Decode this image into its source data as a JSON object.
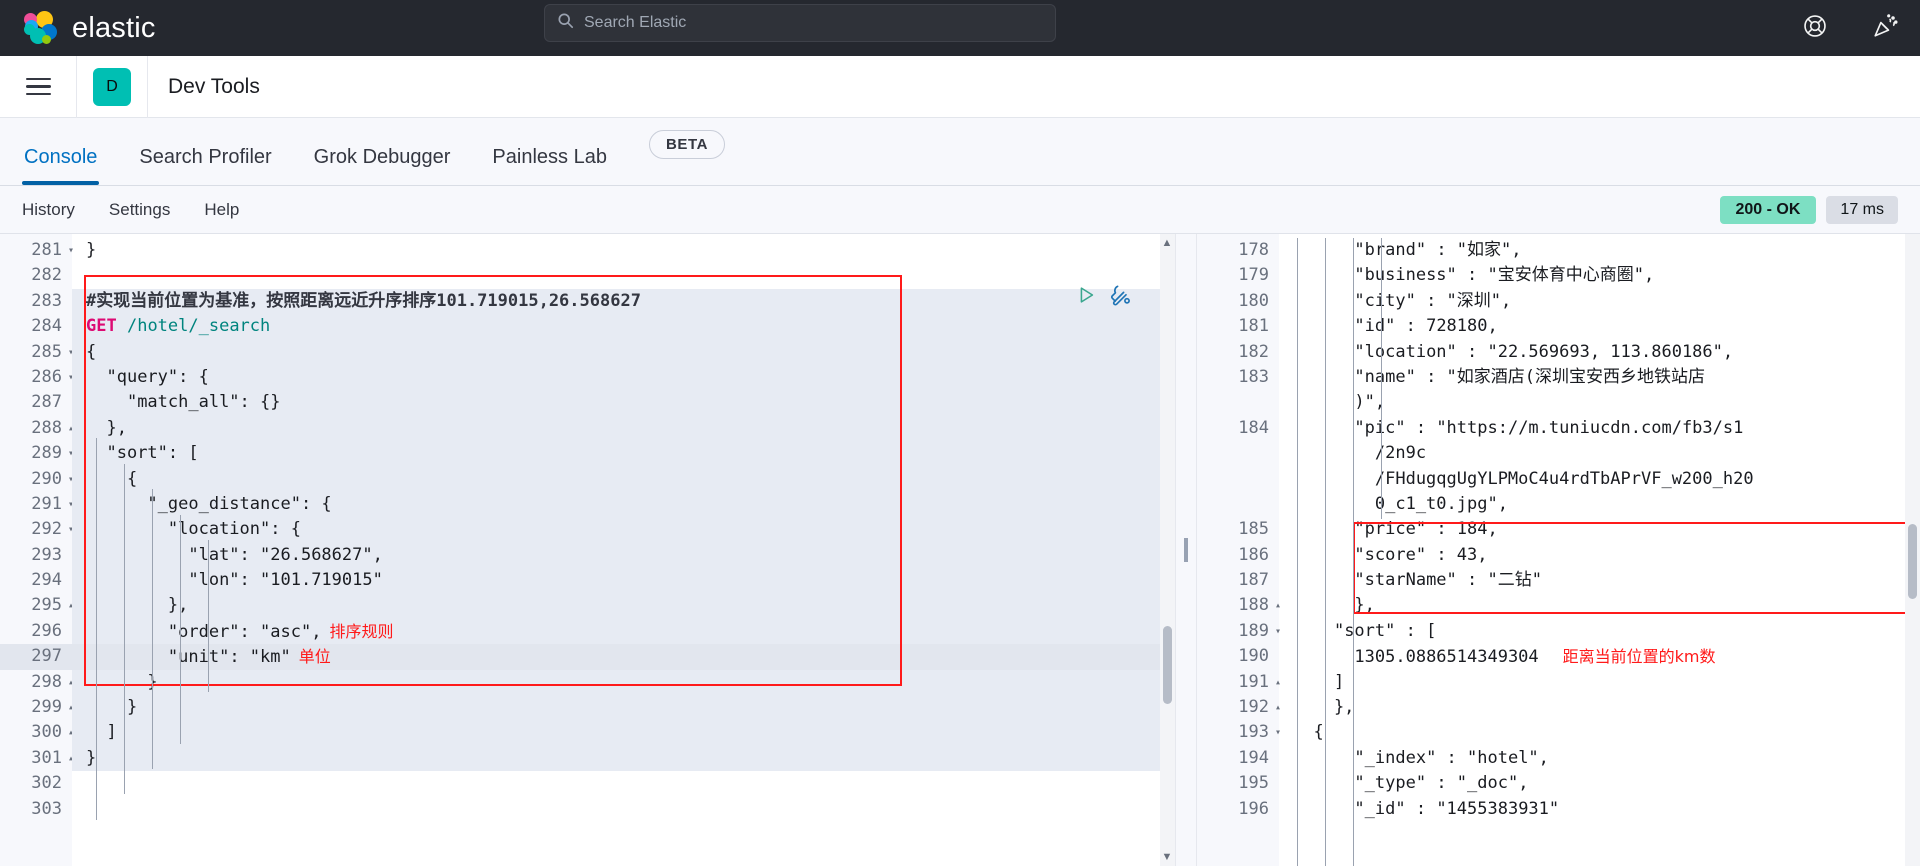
{
  "header": {
    "brand": "elastic",
    "search_placeholder": "Search Elastic",
    "icons": {
      "help": "lifebuoy-icon",
      "whats_new": "party-popper-icon"
    }
  },
  "appbar": {
    "menu_icon": "hamburger-menu-icon",
    "space_badge": "D",
    "title": "Dev Tools"
  },
  "tabs": [
    {
      "label": "Console",
      "active": true
    },
    {
      "label": "Search Profiler",
      "active": false
    },
    {
      "label": "Grok Debugger",
      "active": false
    },
    {
      "label": "Painless Lab",
      "active": false
    }
  ],
  "beta_tag": "BETA",
  "console_toolbar": {
    "items": [
      "History",
      "Settings",
      "Help"
    ],
    "status_code": "200 - OK",
    "status_time": "17 ms"
  },
  "editor": {
    "first_line": 281,
    "lines": [
      {
        "n": 281,
        "fold": "down",
        "text": "}"
      },
      {
        "n": 282,
        "fold": "",
        "text": ""
      },
      {
        "n": 283,
        "fold": "",
        "text": "#实现当前位置为基准，按照距离远近升序排序101.719015,26.568627"
      },
      {
        "n": 284,
        "fold": "",
        "text": "GET /hotel/_search"
      },
      {
        "n": 285,
        "fold": "down",
        "text": "{"
      },
      {
        "n": 286,
        "fold": "down",
        "text": "  \"query\": {"
      },
      {
        "n": 287,
        "fold": "",
        "text": "    \"match_all\": {}"
      },
      {
        "n": 288,
        "fold": "up",
        "text": "  },"
      },
      {
        "n": 289,
        "fold": "down",
        "text": "  \"sort\": ["
      },
      {
        "n": 290,
        "fold": "down",
        "text": "    {"
      },
      {
        "n": 291,
        "fold": "down",
        "text": "      \"_geo_distance\": {"
      },
      {
        "n": 292,
        "fold": "down",
        "text": "        \"location\": {"
      },
      {
        "n": 293,
        "fold": "",
        "text": "          \"lat\": \"26.568627\","
      },
      {
        "n": 294,
        "fold": "",
        "text": "          \"lon\": \"101.719015\""
      },
      {
        "n": 295,
        "fold": "up",
        "text": "        },"
      },
      {
        "n": 296,
        "fold": "",
        "text": "        \"order\": \"asc\","
      },
      {
        "n": 297,
        "fold": "",
        "text": "        \"unit\": \"km\""
      },
      {
        "n": 298,
        "fold": "up",
        "text": "      }"
      },
      {
        "n": 299,
        "fold": "up",
        "text": "    }"
      },
      {
        "n": 300,
        "fold": "up",
        "text": "  ]"
      },
      {
        "n": 301,
        "fold": "up",
        "text": "}"
      },
      {
        "n": 302,
        "fold": "",
        "text": ""
      },
      {
        "n": 303,
        "fold": "",
        "text": ""
      }
    ],
    "annotations": [
      {
        "text": "排序规则",
        "for_line": 296
      },
      {
        "text": "单位",
        "for_line": 297
      }
    ],
    "run_icon": "play-triangle-icon",
    "wrench_icon": "wrench-icon",
    "highlighted_line": 297
  },
  "response": {
    "first_line": 178,
    "lines": [
      {
        "n": 178,
        "fold": "",
        "text": "\"brand\" : \"如家\","
      },
      {
        "n": 179,
        "fold": "",
        "text": "\"business\" : \"宝安体育中心商圈\","
      },
      {
        "n": 180,
        "fold": "",
        "text": "\"city\" : \"深圳\","
      },
      {
        "n": 181,
        "fold": "",
        "text": "\"id\" : 728180,"
      },
      {
        "n": 182,
        "fold": "",
        "text": "\"location\" : \"22.569693, 113.860186\","
      },
      {
        "n": 183,
        "fold": "",
        "text": "\"name\" : \"如家酒店(深圳宝安西乡地铁站店)\","
      },
      {
        "n": 184,
        "fold": "",
        "text": "\"pic\" : \"https://m.tuniucdn.com/fb3/s1/2n9c/FHdugqgUgYLPMoC4u4rdTbAPrVF_w200_h200_c1_t0.jpg\","
      },
      {
        "n": 185,
        "fold": "",
        "text": "\"price\" : 184,"
      },
      {
        "n": 186,
        "fold": "",
        "text": "\"score\" : 43,"
      },
      {
        "n": 187,
        "fold": "",
        "text": "\"starName\" : \"二钻\""
      },
      {
        "n": 188,
        "fold": "up",
        "text": "},"
      },
      {
        "n": 189,
        "fold": "down",
        "text": "\"sort\" : ["
      },
      {
        "n": 190,
        "fold": "",
        "text": "  1305.0886514349304"
      },
      {
        "n": 191,
        "fold": "up",
        "text": "]"
      },
      {
        "n": 192,
        "fold": "up",
        "text": "},"
      },
      {
        "n": 193,
        "fold": "down",
        "text": "{"
      },
      {
        "n": 194,
        "fold": "",
        "text": "\"_index\" : \"hotel\","
      },
      {
        "n": 195,
        "fold": "",
        "text": "\"_type\" : \"_doc\","
      },
      {
        "n": 196,
        "fold": "",
        "text": "\"_id\" : \"1455383931\""
      }
    ],
    "annotations": [
      {
        "text": "距离当前位置的km数",
        "for_line": 190
      }
    ],
    "values": {
      "brand": "如家",
      "business": "宝安体育中心商圈",
      "city": "深圳",
      "id": 728180,
      "location": "22.569693, 113.860186",
      "name": "如家酒店(深圳宝安西乡地铁站店)",
      "pic": "https://m.tuniucdn.com/fb3/s1/2n9c/FHdugqgUgYLPMoC4u4rdTbAPrVF_w200_h200_c1_t0.jpg",
      "price": 184,
      "score": 43,
      "starName": "二钻",
      "sort_distance_km": 1305.0886514349304,
      "_index": "hotel",
      "_type": "_doc",
      "_id": "1455383931"
    }
  },
  "colors": {
    "brand_dark": "#25282f",
    "accent_blue": "#0071c2",
    "teal": "#00bfb3",
    "status_green": "#7ddfc3",
    "annotation_red": "#ff1a1a"
  }
}
